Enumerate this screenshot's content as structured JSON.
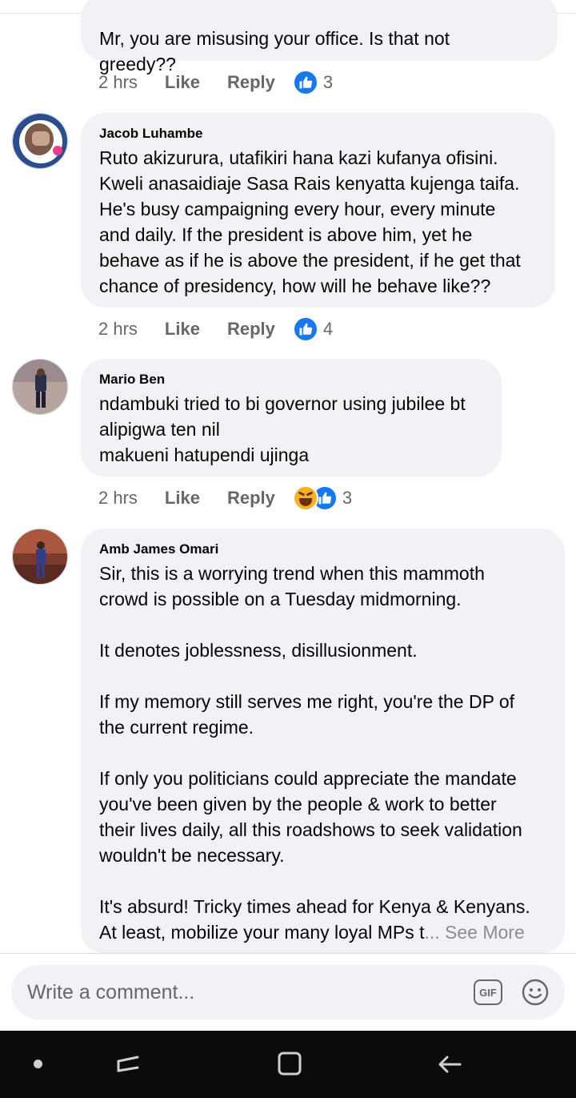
{
  "comments": [
    {
      "name": "",
      "text_lines": [
        "Mr, you are misusing your office. Is that not",
        "greedy??"
      ],
      "time": "2 hrs",
      "like_label": "Like",
      "reply_label": "Reply",
      "reactions": [
        "like-reaction-icon"
      ],
      "reaction_count": "3"
    },
    {
      "name": "Jacob Luhambe",
      "text": "Ruto akizurura, utafikiri hana kazi kufanya ofisini.\nKweli anasaidiaje Sasa Rais kenyatta kujenga taifa.\nHe's busy campaigning  every hour, every minute\nand daily. If the president is above him, yet he\nbehave as if he is above the president, if he get that\nchance of presidency, how will he behave like??",
      "time": "2 hrs",
      "like_label": "Like",
      "reply_label": "Reply",
      "reactions": [
        "like-reaction-icon"
      ],
      "reaction_count": "4"
    },
    {
      "name": "Mario Ben",
      "text": "ndambuki tried to bi governor using jubilee bt\nalipigwa ten nil\nmakueni hatupendi ujinga",
      "time": "2 hrs",
      "like_label": "Like",
      "reply_label": "Reply",
      "reactions": [
        "haha-reaction-icon",
        "like-reaction-icon"
      ],
      "reaction_count": "3"
    },
    {
      "name": "Amb James Omari",
      "text": "Sir, this is a worrying trend when this mammoth\ncrowd is possible on a Tuesday midmorning.\n\nIt denotes joblessness, disillusionment.\n\nIf my memory still serves me right, you're the DP of\nthe current regime.\n\nIf only you politicians could appreciate the mandate\nyou've been given by the people & work to better\ntheir lives daily, all this roadshows to seek validation\nwouldn't be necessary.\n\nIt's absurd! Tricky times ahead for Kenya & Kenyans.\nAt least, mobilize your many loyal MPs t",
      "ellipsis": "...",
      "see_more": "See More"
    }
  ],
  "composer": {
    "placeholder": "Write a comment...",
    "gif_label": "GIF",
    "emoji_icon": "emoji-icon"
  },
  "navbar": {
    "icons": [
      "home-dot-icon",
      "recent-apps-icon",
      "home-icon",
      "back-icon"
    ]
  },
  "colors": {
    "bubble": "#f0f2f5",
    "meta_text": "#65676b",
    "like_blue": "#1877f2",
    "navbar": "#0b0b0b"
  }
}
